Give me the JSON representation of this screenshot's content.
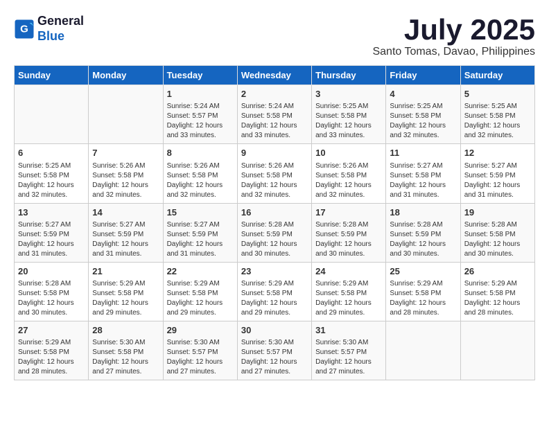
{
  "header": {
    "logo_line1": "General",
    "logo_line2": "Blue",
    "month_title": "July 2025",
    "subtitle": "Santo Tomas, Davao, Philippines"
  },
  "days_of_week": [
    "Sunday",
    "Monday",
    "Tuesday",
    "Wednesday",
    "Thursday",
    "Friday",
    "Saturday"
  ],
  "weeks": [
    [
      {
        "day": "",
        "info": ""
      },
      {
        "day": "",
        "info": ""
      },
      {
        "day": "1",
        "info": "Sunrise: 5:24 AM\nSunset: 5:57 PM\nDaylight: 12 hours\nand 33 minutes."
      },
      {
        "day": "2",
        "info": "Sunrise: 5:24 AM\nSunset: 5:58 PM\nDaylight: 12 hours\nand 33 minutes."
      },
      {
        "day": "3",
        "info": "Sunrise: 5:25 AM\nSunset: 5:58 PM\nDaylight: 12 hours\nand 33 minutes."
      },
      {
        "day": "4",
        "info": "Sunrise: 5:25 AM\nSunset: 5:58 PM\nDaylight: 12 hours\nand 32 minutes."
      },
      {
        "day": "5",
        "info": "Sunrise: 5:25 AM\nSunset: 5:58 PM\nDaylight: 12 hours\nand 32 minutes."
      }
    ],
    [
      {
        "day": "6",
        "info": "Sunrise: 5:25 AM\nSunset: 5:58 PM\nDaylight: 12 hours\nand 32 minutes."
      },
      {
        "day": "7",
        "info": "Sunrise: 5:26 AM\nSunset: 5:58 PM\nDaylight: 12 hours\nand 32 minutes."
      },
      {
        "day": "8",
        "info": "Sunrise: 5:26 AM\nSunset: 5:58 PM\nDaylight: 12 hours\nand 32 minutes."
      },
      {
        "day": "9",
        "info": "Sunrise: 5:26 AM\nSunset: 5:58 PM\nDaylight: 12 hours\nand 32 minutes."
      },
      {
        "day": "10",
        "info": "Sunrise: 5:26 AM\nSunset: 5:58 PM\nDaylight: 12 hours\nand 32 minutes."
      },
      {
        "day": "11",
        "info": "Sunrise: 5:27 AM\nSunset: 5:58 PM\nDaylight: 12 hours\nand 31 minutes."
      },
      {
        "day": "12",
        "info": "Sunrise: 5:27 AM\nSunset: 5:59 PM\nDaylight: 12 hours\nand 31 minutes."
      }
    ],
    [
      {
        "day": "13",
        "info": "Sunrise: 5:27 AM\nSunset: 5:59 PM\nDaylight: 12 hours\nand 31 minutes."
      },
      {
        "day": "14",
        "info": "Sunrise: 5:27 AM\nSunset: 5:59 PM\nDaylight: 12 hours\nand 31 minutes."
      },
      {
        "day": "15",
        "info": "Sunrise: 5:27 AM\nSunset: 5:59 PM\nDaylight: 12 hours\nand 31 minutes."
      },
      {
        "day": "16",
        "info": "Sunrise: 5:28 AM\nSunset: 5:59 PM\nDaylight: 12 hours\nand 30 minutes."
      },
      {
        "day": "17",
        "info": "Sunrise: 5:28 AM\nSunset: 5:59 PM\nDaylight: 12 hours\nand 30 minutes."
      },
      {
        "day": "18",
        "info": "Sunrise: 5:28 AM\nSunset: 5:59 PM\nDaylight: 12 hours\nand 30 minutes."
      },
      {
        "day": "19",
        "info": "Sunrise: 5:28 AM\nSunset: 5:58 PM\nDaylight: 12 hours\nand 30 minutes."
      }
    ],
    [
      {
        "day": "20",
        "info": "Sunrise: 5:28 AM\nSunset: 5:58 PM\nDaylight: 12 hours\nand 30 minutes."
      },
      {
        "day": "21",
        "info": "Sunrise: 5:29 AM\nSunset: 5:58 PM\nDaylight: 12 hours\nand 29 minutes."
      },
      {
        "day": "22",
        "info": "Sunrise: 5:29 AM\nSunset: 5:58 PM\nDaylight: 12 hours\nand 29 minutes."
      },
      {
        "day": "23",
        "info": "Sunrise: 5:29 AM\nSunset: 5:58 PM\nDaylight: 12 hours\nand 29 minutes."
      },
      {
        "day": "24",
        "info": "Sunrise: 5:29 AM\nSunset: 5:58 PM\nDaylight: 12 hours\nand 29 minutes."
      },
      {
        "day": "25",
        "info": "Sunrise: 5:29 AM\nSunset: 5:58 PM\nDaylight: 12 hours\nand 28 minutes."
      },
      {
        "day": "26",
        "info": "Sunrise: 5:29 AM\nSunset: 5:58 PM\nDaylight: 12 hours\nand 28 minutes."
      }
    ],
    [
      {
        "day": "27",
        "info": "Sunrise: 5:29 AM\nSunset: 5:58 PM\nDaylight: 12 hours\nand 28 minutes."
      },
      {
        "day": "28",
        "info": "Sunrise: 5:30 AM\nSunset: 5:58 PM\nDaylight: 12 hours\nand 27 minutes."
      },
      {
        "day": "29",
        "info": "Sunrise: 5:30 AM\nSunset: 5:57 PM\nDaylight: 12 hours\nand 27 minutes."
      },
      {
        "day": "30",
        "info": "Sunrise: 5:30 AM\nSunset: 5:57 PM\nDaylight: 12 hours\nand 27 minutes."
      },
      {
        "day": "31",
        "info": "Sunrise: 5:30 AM\nSunset: 5:57 PM\nDaylight: 12 hours\nand 27 minutes."
      },
      {
        "day": "",
        "info": ""
      },
      {
        "day": "",
        "info": ""
      }
    ]
  ]
}
